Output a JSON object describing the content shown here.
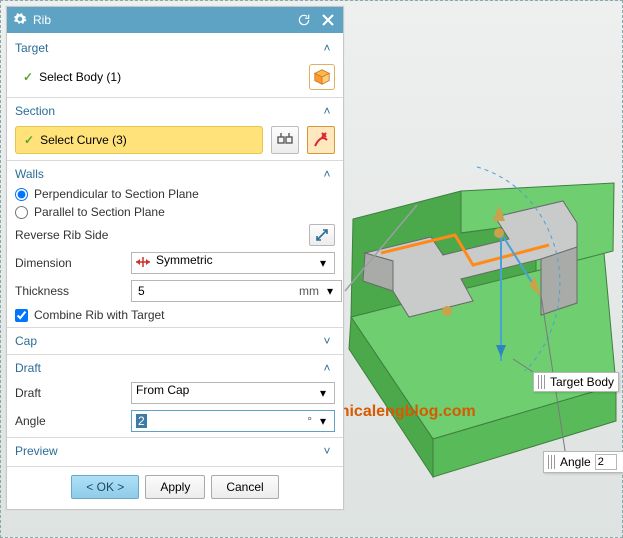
{
  "window": {
    "title": "Rib"
  },
  "target": {
    "title": "Target",
    "select_body_label": "Select Body (1)"
  },
  "section": {
    "title": "Section",
    "select_curve_label": "Select Curve (3)"
  },
  "walls": {
    "title": "Walls",
    "radio_perp": "Perpendicular to Section Plane",
    "radio_par": "Parallel to Section Plane",
    "reverse_label": "Reverse Rib Side",
    "dim_label": "Dimension",
    "dim_value": "Symmetric",
    "thk_label": "Thickness",
    "thk_value": "5",
    "thk_unit": "mm",
    "combine_label": "Combine Rib with Target"
  },
  "cap": {
    "title": "Cap"
  },
  "draft": {
    "title": "Draft",
    "draft_label": "Draft",
    "draft_value": "From Cap",
    "angle_label": "Angle",
    "angle_value": "2",
    "angle_unit": "°"
  },
  "preview": {
    "title": "Preview"
  },
  "buttons": {
    "ok": "< OK >",
    "apply": "Apply",
    "cancel": "Cancel"
  },
  "viewport": {
    "target_body_label": "Target Body",
    "angle_callout_label": "Angle",
    "angle_callout_value": "2"
  },
  "watermark": "mechanicalengblog.com",
  "icons": {
    "gear": "gear-icon",
    "reset": "reset-icon",
    "close": "close-icon",
    "cube": "cube-icon",
    "sketch": "sketch-region-icon",
    "curve": "curve-rule-icon",
    "reverse": "reverse-icon",
    "sym": "symmetric-icon",
    "chev_up": "chevron-up-icon",
    "chev_down": "chevron-down-icon",
    "dd": "dropdown-icon"
  }
}
